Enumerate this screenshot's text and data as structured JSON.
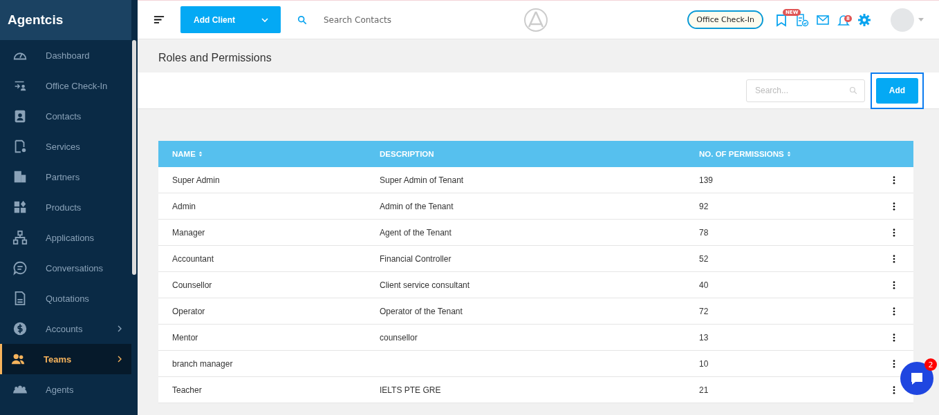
{
  "brand": "Agentcis",
  "sidebar": {
    "items": [
      {
        "label": "Dashboard",
        "selected": false,
        "submenu": false
      },
      {
        "label": "Office Check-In",
        "selected": false,
        "submenu": false
      },
      {
        "label": "Contacts",
        "selected": false,
        "submenu": false
      },
      {
        "label": "Services",
        "selected": false,
        "submenu": false
      },
      {
        "label": "Partners",
        "selected": false,
        "submenu": false
      },
      {
        "label": "Products",
        "selected": false,
        "submenu": false
      },
      {
        "label": "Applications",
        "selected": false,
        "submenu": false
      },
      {
        "label": "Conversations",
        "selected": false,
        "submenu": false
      },
      {
        "label": "Quotations",
        "selected": false,
        "submenu": false
      },
      {
        "label": "Accounts",
        "selected": false,
        "submenu": true
      },
      {
        "label": "Teams",
        "selected": true,
        "submenu": true
      },
      {
        "label": "Agents",
        "selected": false,
        "submenu": false
      }
    ]
  },
  "topbar": {
    "add_client": "Add Client",
    "search": {
      "placeholder": "Search Contacts"
    },
    "check_in": "Office Check-In",
    "new_badge": "NEW",
    "notification_count": "8"
  },
  "page_title": "Roles and Permissions",
  "toolbar": {
    "search": {
      "placeholder": "Search..."
    },
    "add": "Add"
  },
  "table": {
    "columns": [
      {
        "label": "NAME",
        "sortable": true
      },
      {
        "label": "DESCRIPTION",
        "sortable": false
      },
      {
        "label": "NO. OF PERMISSIONS",
        "sortable": true
      }
    ],
    "rows": [
      {
        "name": "Super Admin",
        "description": "Super Admin of Tenant",
        "permissions": "139"
      },
      {
        "name": "Admin",
        "description": "Admin of the Tenant",
        "permissions": "92"
      },
      {
        "name": "Manager",
        "description": "Agent of the Tenant",
        "permissions": "78"
      },
      {
        "name": "Accountant",
        "description": "Financial Controller",
        "permissions": "52"
      },
      {
        "name": "Counsellor",
        "description": "Client service consultant",
        "permissions": "40"
      },
      {
        "name": "Operator",
        "description": "Operator of the Tenant",
        "permissions": "72"
      },
      {
        "name": "Mentor",
        "description": "counsellor",
        "permissions": "13"
      },
      {
        "name": "branch manager",
        "description": "",
        "permissions": "10"
      },
      {
        "name": "Teacher",
        "description": "IELTS PTE GRE",
        "permissions": "21"
      }
    ]
  },
  "chat": {
    "unread": "2"
  }
}
